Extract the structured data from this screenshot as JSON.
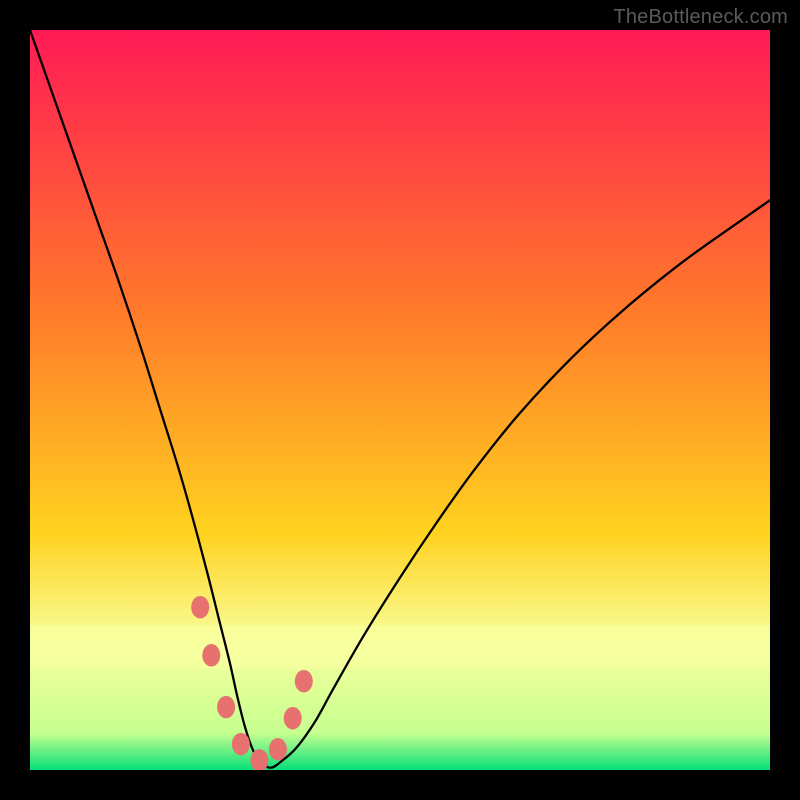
{
  "watermark": "TheBottleneck.com",
  "colors": {
    "frame": "#000000",
    "gradient_top": "#ff1a55",
    "gradient_mid1": "#ff7a2a",
    "gradient_mid2": "#ffd21f",
    "gradient_band": "#f8ff9e",
    "gradient_bottom": "#06e079",
    "curve": "#000000",
    "marker": "#e6716e"
  },
  "chart_data": {
    "type": "line",
    "title": "",
    "xlabel": "",
    "ylabel": "",
    "xlim": [
      0,
      100
    ],
    "ylim": [
      0,
      100
    ],
    "series": [
      {
        "name": "bottleneck-curve",
        "x": [
          0,
          3,
          6,
          9,
          12,
          15,
          17.5,
          20,
          22,
          24,
          25.5,
          27,
          28,
          29,
          30,
          31,
          32.5,
          34,
          36,
          38.5,
          41,
          45,
          50,
          55,
          60,
          66,
          73,
          80,
          88,
          95,
          100
        ],
        "y": [
          100,
          91.5,
          83,
          74.5,
          66,
          57,
          49,
          41,
          34,
          26.5,
          20.5,
          14.5,
          10,
          6,
          3,
          1.2,
          0.3,
          1.2,
          3,
          6.5,
          11,
          18,
          26,
          33.5,
          40.5,
          48,
          55.5,
          62,
          68.5,
          73.5,
          77
        ]
      }
    ],
    "markers": [
      {
        "x": 23.0,
        "y": 22.0
      },
      {
        "x": 24.5,
        "y": 15.5
      },
      {
        "x": 26.5,
        "y": 8.5
      },
      {
        "x": 28.5,
        "y": 3.5
      },
      {
        "x": 31.0,
        "y": 1.3
      },
      {
        "x": 33.5,
        "y": 2.8
      },
      {
        "x": 35.5,
        "y": 7.0
      },
      {
        "x": 37.0,
        "y": 12.0
      }
    ]
  }
}
